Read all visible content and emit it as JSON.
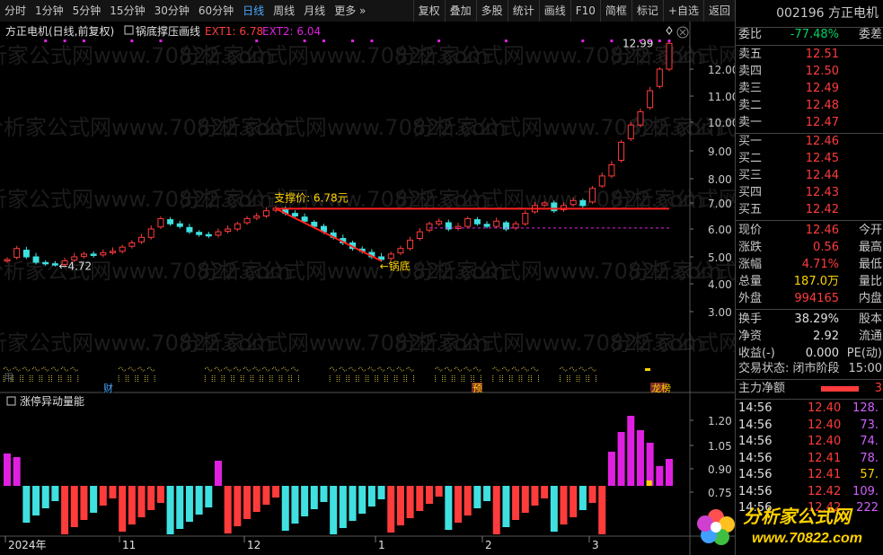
{
  "toolbar": {
    "periods": [
      "分时",
      "1分钟",
      "5分钟",
      "15分钟",
      "30分钟",
      "60分钟",
      "日线",
      "周线",
      "月线",
      "更多 »"
    ],
    "active": "日线",
    "tools": [
      "复权",
      "叠加",
      "多股",
      "统计",
      "画线",
      "F10",
      "简框",
      "标记",
      "+自选",
      "返回"
    ]
  },
  "chart": {
    "title": "方正电机(日线,前复权)",
    "indicator_name": "锅底撑压画线",
    "ext1": "EXT1: 6.78",
    "ext2": "EXT2: 6.04",
    "sub_indicator": "涨停异动量能",
    "y_ticks": [
      "12.00",
      "11.00",
      "10.00",
      "9.00",
      "8.00",
      "7.00",
      "6.00",
      "5.00",
      "4.00",
      "3.00"
    ],
    "sub_ticks": [
      "1.20",
      "1.05",
      "0.90",
      "0.75"
    ],
    "x_labels": [
      "2024年",
      "11",
      "12",
      "1",
      "2",
      "3"
    ],
    "support_label": "支撑价: 6.78元",
    "low_label": "4.72",
    "high_label": "12.99",
    "bottom_label": "锅底",
    "markers": [
      "财",
      "预",
      "龙榜"
    ],
    "cut_text": "用"
  },
  "chart_data": {
    "type": "candlestick",
    "closes": [
      4.9,
      5.3,
      5.0,
      4.8,
      4.75,
      4.72,
      4.85,
      5.0,
      5.1,
      5.05,
      5.15,
      5.2,
      5.35,
      5.5,
      5.7,
      6.0,
      6.4,
      6.2,
      6.1,
      5.9,
      5.8,
      5.75,
      5.9,
      6.0,
      6.2,
      6.4,
      6.5,
      6.7,
      6.8,
      6.6,
      6.5,
      6.3,
      6.1,
      5.9,
      5.7,
      5.5,
      5.3,
      5.2,
      5.0,
      4.9,
      5.1,
      5.3,
      5.6,
      5.9,
      6.2,
      6.3,
      6.0,
      6.1,
      6.4,
      6.2,
      6.1,
      6.3,
      6.0,
      6.2,
      6.6,
      6.9,
      7.0,
      6.7,
      6.9,
      7.1,
      6.9,
      7.6,
      8.1,
      8.5,
      9.3,
      9.9,
      10.4,
      11.2,
      12.0,
      12.99
    ],
    "support_price": 6.78,
    "ext2": 6.04,
    "y_range": [
      3.0,
      12.99
    ]
  },
  "quote": {
    "code_name": "002196 方正电机",
    "ratio_label": "委比",
    "ratio": "-77.48%",
    "diff_label": "委差",
    "asks": [
      [
        "卖五",
        "12.51"
      ],
      [
        "卖四",
        "12.50"
      ],
      [
        "卖三",
        "12.49"
      ],
      [
        "卖二",
        "12.48"
      ],
      [
        "卖一",
        "12.47"
      ]
    ],
    "bids": [
      [
        "买一",
        "12.46"
      ],
      [
        "买二",
        "12.45"
      ],
      [
        "买三",
        "12.44"
      ],
      [
        "买四",
        "12.43"
      ],
      [
        "买五",
        "12.42"
      ]
    ],
    "stats": [
      [
        "现价",
        "12.46",
        "今开"
      ],
      [
        "涨跌",
        "0.56",
        "最高"
      ],
      [
        "涨幅",
        "4.71%",
        "最低"
      ],
      [
        "总量",
        "187.0万",
        "量比"
      ],
      [
        "外盘",
        "994165",
        "内盘"
      ],
      [
        "换手",
        "38.29%",
        "股本"
      ],
      [
        "净资",
        "2.92",
        "流通"
      ],
      [
        "收益(-)",
        "0.000",
        "PE(动)"
      ]
    ],
    "trade_status_label": "交易状态: 闭市阶段",
    "trade_time": "15:00",
    "net_inflow_label": "主力净额",
    "net_inflow_value": "3",
    "ticks": [
      [
        "14:56",
        "12.40",
        "128."
      ],
      [
        "14:56",
        "12.40",
        "73."
      ],
      [
        "14:56",
        "12.40",
        "74."
      ],
      [
        "14:56",
        "12.41",
        "78."
      ],
      [
        "14:56",
        "12.41",
        "57."
      ],
      [
        "14:56",
        "12.42",
        "109."
      ],
      [
        "14:56",
        "12.42",
        "222"
      ]
    ]
  },
  "watermark": "分析家公式网www.70822.com",
  "logo": {
    "title": "分析家公式网",
    "url": "www.70822.com"
  },
  "colors": {
    "up": "#ff3c3c",
    "down": "#40e0e0",
    "support": "#ff2020",
    "magenta": "#e020e0",
    "yellow": "#ffd200",
    "blue": "#4aa8ff"
  }
}
